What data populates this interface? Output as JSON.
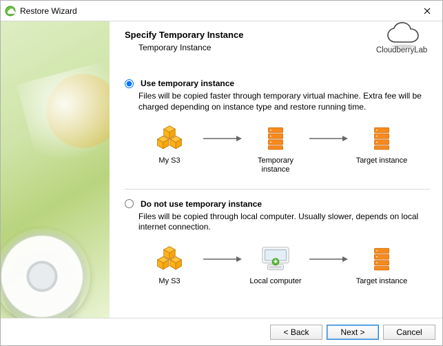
{
  "window": {
    "title": "Restore Wizard"
  },
  "brand": {
    "name": "CloudberryLab"
  },
  "page": {
    "heading": "Specify Temporary Instance",
    "subheading": "Temporary Instance"
  },
  "options": {
    "use": {
      "label": "Use temporary instance",
      "description": "Files will be copied faster through temporary virtual machine. Extra fee will be charged depending on instance type and restore running time.",
      "flow": {
        "source": "My S3",
        "middle": "Temporary instance",
        "target": "Target instance"
      }
    },
    "skip": {
      "label": "Do not use temporary instance",
      "description": "Files will be copied through local computer. Usually slower, depends on local internet connection.",
      "flow": {
        "source": "My S3",
        "middle": "Local computer",
        "target": "Target instance"
      }
    }
  },
  "buttons": {
    "back": "< Back",
    "next": "Next >",
    "cancel": "Cancel"
  }
}
